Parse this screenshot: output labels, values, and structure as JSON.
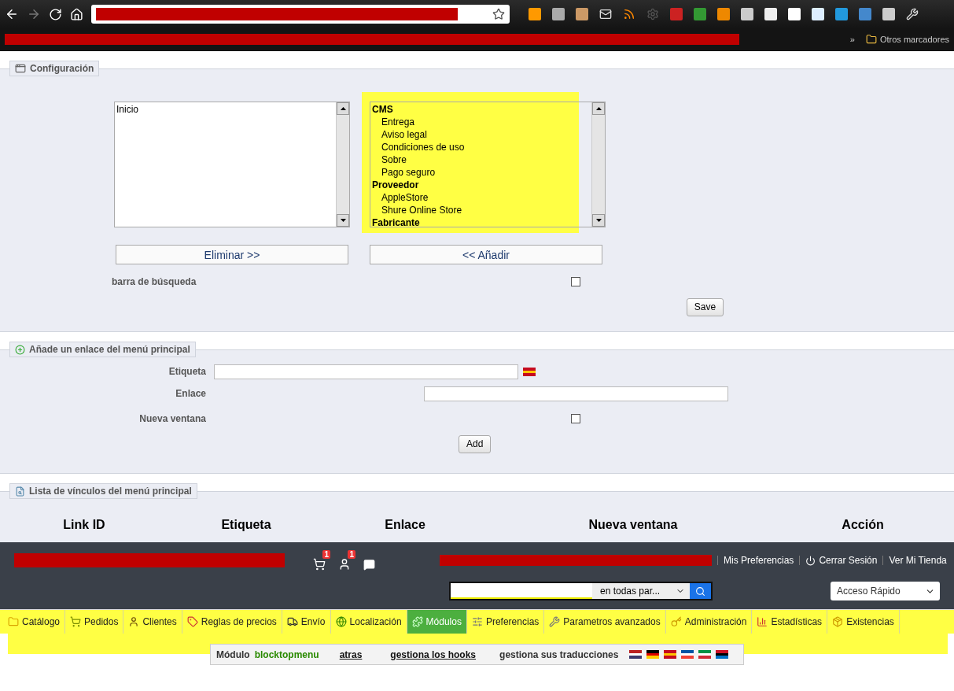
{
  "browser": {
    "bookmarks_overflow": "»",
    "other_bookmarks": "Otros marcadores"
  },
  "config": {
    "title": "Configuración",
    "left_list": [
      {
        "label": "Inicio",
        "selected": false
      }
    ],
    "right_list": [
      {
        "label": "CMS",
        "kind": "group",
        "selected": false,
        "children": [
          {
            "label": "Entrega",
            "selected": false
          },
          {
            "label": "Aviso legal",
            "selected": false
          },
          {
            "label": "Condiciones de uso",
            "selected": false
          },
          {
            "label": "Sobre",
            "selected": false
          },
          {
            "label": "Pago seguro",
            "selected": false
          }
        ]
      },
      {
        "label": "Proveedor",
        "kind": "group",
        "selected": false,
        "children": [
          {
            "label": "AppleStore",
            "selected": false
          },
          {
            "label": "Shure Online Store",
            "selected": false
          }
        ]
      },
      {
        "label": "Fabricante",
        "kind": "group",
        "selected": false
      }
    ],
    "remove_button": "Eliminar >>",
    "add_button": "<< Añadir",
    "search_bar": {
      "label": "barra de búsqueda",
      "checked": false
    },
    "save_button": "Save"
  },
  "add_link": {
    "title": "Añade un enlace del menú principal",
    "label_field": {
      "label": "Etiqueta"
    },
    "link_field": {
      "label": "Enlace"
    },
    "new_window": {
      "label": "Nueva ventana",
      "checked": false
    },
    "add_button": "Add"
  },
  "link_list": {
    "title": "Lista de vínculos del menú principal",
    "columns": [
      "Link ID",
      "Etiqueta",
      "Enlace",
      "Nueva ventana",
      "Acción"
    ]
  },
  "admin_header": {
    "cart_badge": "1",
    "customers_badge": "1",
    "links": [
      "Mis Preferencias",
      "Cerrar Sesión",
      "Ver Mi Tienda"
    ],
    "search_scope": "en todas par...",
    "quick_access": "Acceso Rápido"
  },
  "tabs": [
    {
      "label": "Catálogo",
      "selected": false
    },
    {
      "label": "Pedidos",
      "selected": false
    },
    {
      "label": "Clientes",
      "selected": false
    },
    {
      "label": "Reglas de precios",
      "selected": false
    },
    {
      "label": "Envío",
      "selected": false
    },
    {
      "label": "Localización",
      "selected": false
    },
    {
      "label": "Módulos",
      "selected": true
    },
    {
      "label": "Preferencias",
      "selected": false
    },
    {
      "label": "Parametros avanzados",
      "selected": false
    },
    {
      "label": "Administración",
      "selected": false
    },
    {
      "label": "Estadísticas",
      "selected": false
    },
    {
      "label": "Existencias",
      "selected": false
    }
  ],
  "module_bar": {
    "label": "Módulo",
    "module_name": "blocktopmenu",
    "back_link": "atras",
    "hooks_link": "gestiona los hooks",
    "translations_label": "gestiona sus traducciones"
  }
}
